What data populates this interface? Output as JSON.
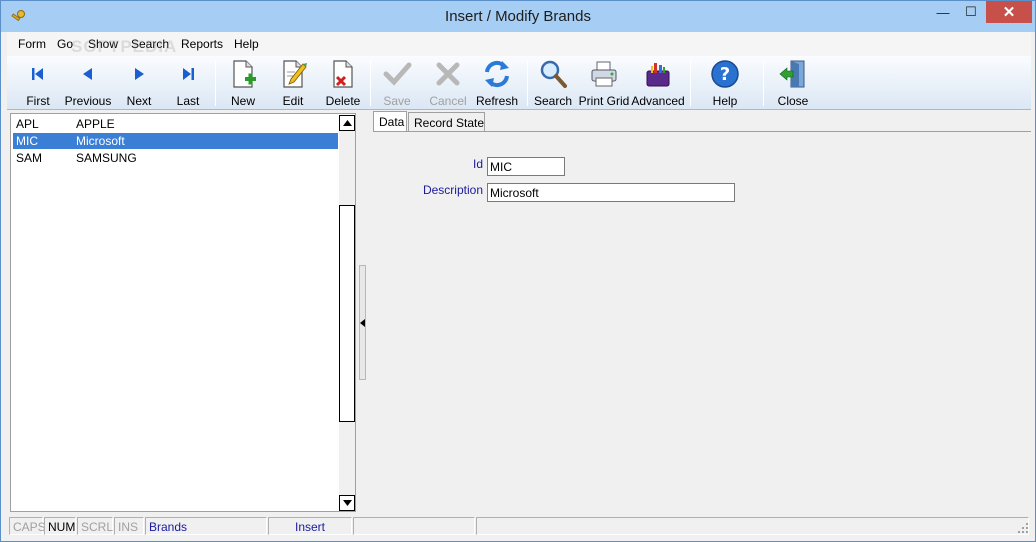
{
  "window": {
    "title": "Insert / Modify Brands",
    "minimize_glyph": "—",
    "maximize_glyph": "☐",
    "close_glyph": "✕"
  },
  "menu": {
    "items": [
      "Form",
      "Go",
      "Show",
      "Search",
      "Reports",
      "Help"
    ]
  },
  "watermark": "SOFTPEDIA",
  "toolbar": {
    "buttons": [
      {
        "label": "First",
        "icon": "first-icon",
        "enabled": true
      },
      {
        "label": "Previous",
        "icon": "previous-icon",
        "enabled": true
      },
      {
        "label": "Next",
        "icon": "next-icon",
        "enabled": true
      },
      {
        "label": "Last",
        "icon": "last-icon",
        "enabled": true
      },
      {
        "label": "New",
        "icon": "new-document-icon",
        "enabled": true
      },
      {
        "label": "Edit",
        "icon": "edit-document-icon",
        "enabled": true
      },
      {
        "label": "Delete",
        "icon": "delete-document-icon",
        "enabled": true
      },
      {
        "label": "Save",
        "icon": "checkmark-icon",
        "enabled": false
      },
      {
        "label": "Cancel",
        "icon": "cross-icon",
        "enabled": false
      },
      {
        "label": "Refresh",
        "icon": "refresh-icon",
        "enabled": true
      },
      {
        "label": "Search",
        "icon": "magnifier-icon",
        "enabled": true
      },
      {
        "label": "Print Grid",
        "icon": "printer-icon",
        "enabled": true
      },
      {
        "label": "Advanced",
        "icon": "toolbox-icon",
        "enabled": true
      },
      {
        "label": "Help",
        "icon": "help-icon",
        "enabled": true
      },
      {
        "label": "Close",
        "icon": "exit-door-icon",
        "enabled": true
      }
    ]
  },
  "list": {
    "rows": [
      {
        "id": "APL",
        "description": "APPLE",
        "selected": false
      },
      {
        "id": "MIC",
        "description": "Microsoft",
        "selected": true
      },
      {
        "id": "SAM",
        "description": "SAMSUNG",
        "selected": false
      }
    ]
  },
  "tabs": [
    {
      "label": "Data",
      "active": true
    },
    {
      "label": "Record State",
      "active": false
    }
  ],
  "form": {
    "id_label": "Id",
    "id_value": "MIC",
    "description_label": "Description",
    "description_value": "Microsoft"
  },
  "status": {
    "caps": "CAPS",
    "num": "NUM",
    "scrl": "SCRL",
    "ins": "INS",
    "table": "Brands",
    "mode": "Insert"
  },
  "colors": {
    "selection": "#3a7fd5",
    "label_blue": "#1a1aa0",
    "title_bar": "#a6cdf3",
    "close_red": "#c7514a"
  }
}
